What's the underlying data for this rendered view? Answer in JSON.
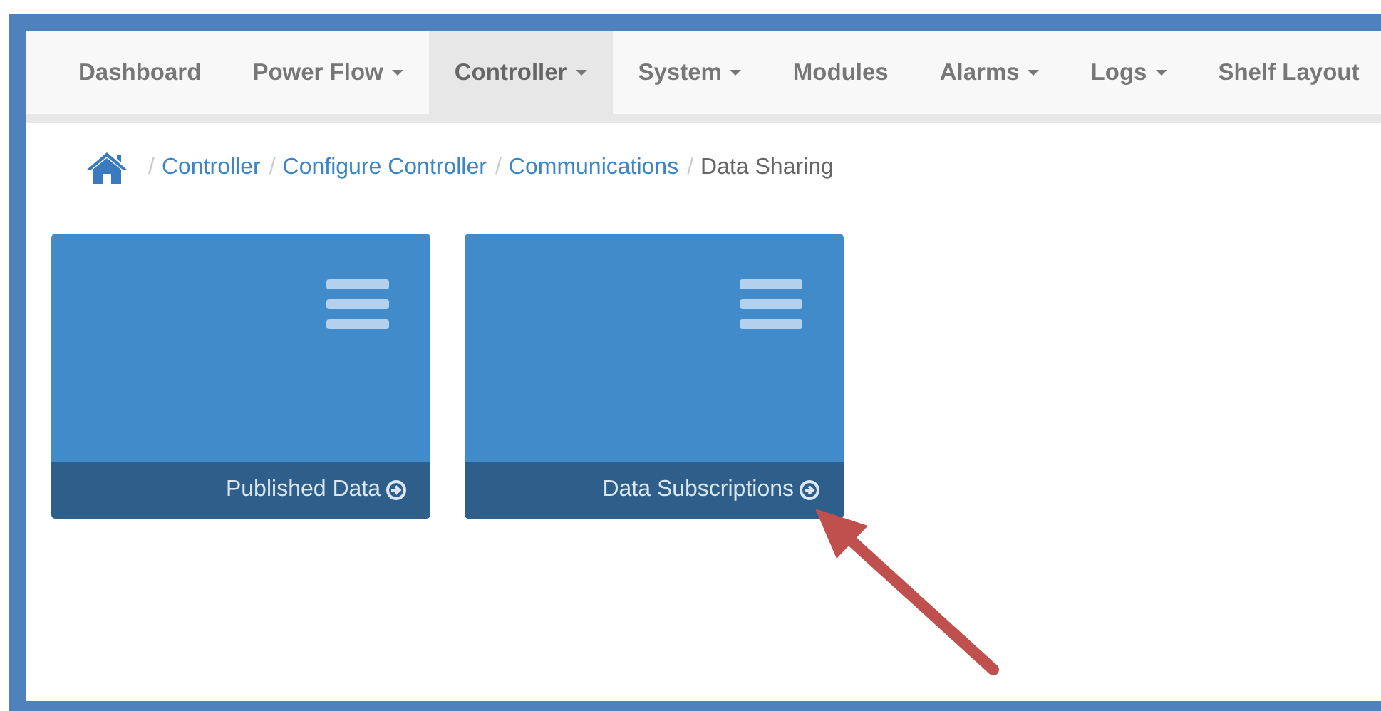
{
  "nav": {
    "items": [
      {
        "label": "Dashboard",
        "dropdown": false,
        "selected": false
      },
      {
        "label": "Power Flow",
        "dropdown": true,
        "selected": false
      },
      {
        "label": "Controller",
        "dropdown": true,
        "selected": true
      },
      {
        "label": "System",
        "dropdown": true,
        "selected": false
      },
      {
        "label": "Modules",
        "dropdown": false,
        "selected": false
      },
      {
        "label": "Alarms",
        "dropdown": true,
        "selected": false
      },
      {
        "label": "Logs",
        "dropdown": true,
        "selected": false
      },
      {
        "label": "Shelf Layout",
        "dropdown": false,
        "selected": false
      }
    ]
  },
  "breadcrumb": {
    "separator": "/",
    "items": [
      {
        "label": "Controller",
        "kind": "link"
      },
      {
        "label": "Configure Controller",
        "kind": "link"
      },
      {
        "label": "Communications",
        "kind": "link"
      },
      {
        "label": "Data Sharing",
        "kind": "current"
      }
    ]
  },
  "tiles": [
    {
      "label": "Published Data"
    },
    {
      "label": "Data Subscriptions"
    }
  ]
}
